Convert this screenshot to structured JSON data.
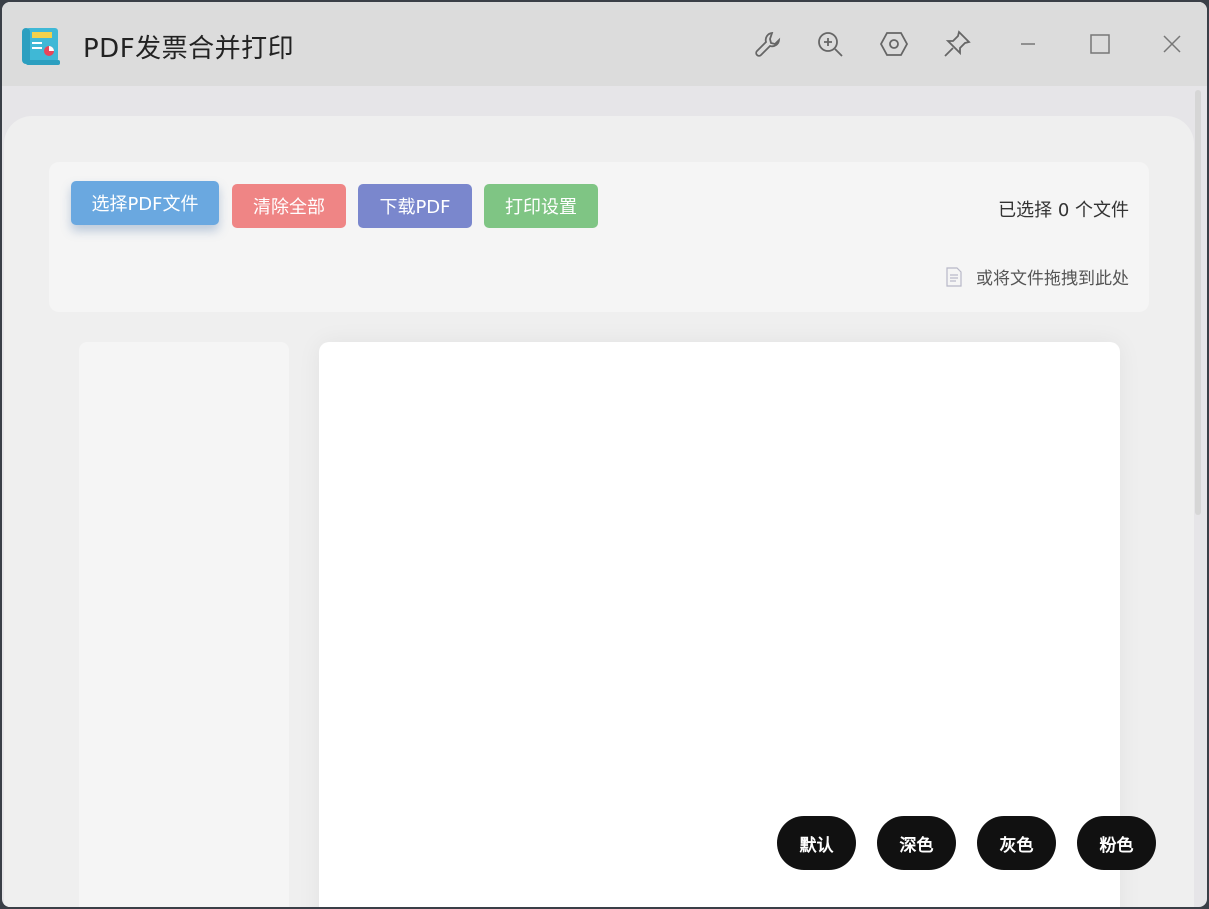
{
  "window": {
    "title": "PDF发票合并打印",
    "controls": {
      "wrench": "wrench-icon",
      "zoom": "zoom-in-icon",
      "settings": "hexagon-settings-icon",
      "pin": "pin-icon",
      "minimize": "minimize-icon",
      "maximize": "maximize-icon",
      "close": "close-icon"
    }
  },
  "toolbar": {
    "select_label": "选择PDF文件",
    "clear_label": "清除全部",
    "download_label": "下载PDF",
    "print_settings_label": "打印设置",
    "selected_count_text": "已选择 0 个文件",
    "drop_hint": "或将文件拖拽到此处"
  },
  "themes": [
    {
      "label": "默认"
    },
    {
      "label": "深色"
    },
    {
      "label": "灰色"
    },
    {
      "label": "粉色"
    }
  ],
  "colors": {
    "select": "#6aa8e0",
    "clear": "#ef8585",
    "download": "#7a87cd",
    "print": "#7fc584",
    "theme_button": "#111111"
  }
}
